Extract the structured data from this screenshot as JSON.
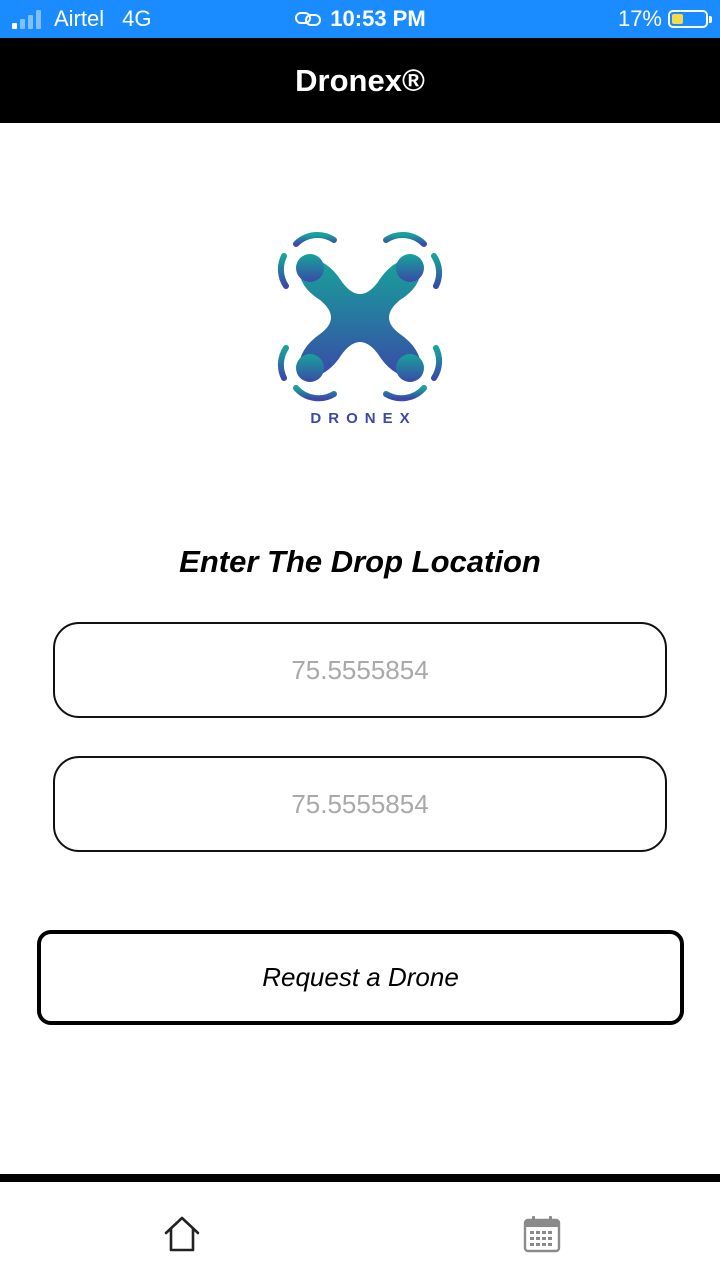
{
  "status_bar": {
    "carrier": "Airtel",
    "network": "4G",
    "time": "10:53 PM",
    "battery_percent": "17%",
    "battery_level": 0.17,
    "signal_bars_active": 1,
    "signal_bars_total": 4,
    "link_icon": "link-icon"
  },
  "header": {
    "title": "Dronex®"
  },
  "logo": {
    "text": "DRONEX",
    "gradient_top": "#16a39a",
    "gradient_bottom": "#3a4aa8"
  },
  "form": {
    "heading": "Enter The Drop Location",
    "latitude_placeholder": "75.5555854",
    "longitude_placeholder": "75.5555854",
    "submit_label": "Request a Drone"
  },
  "tab_bar": {
    "items": [
      {
        "icon": "home-icon"
      },
      {
        "icon": "calendar-icon"
      }
    ]
  },
  "colors": {
    "status_bar": "#1a8cff",
    "header": "#000000",
    "battery_fill": "#f7d94c"
  }
}
